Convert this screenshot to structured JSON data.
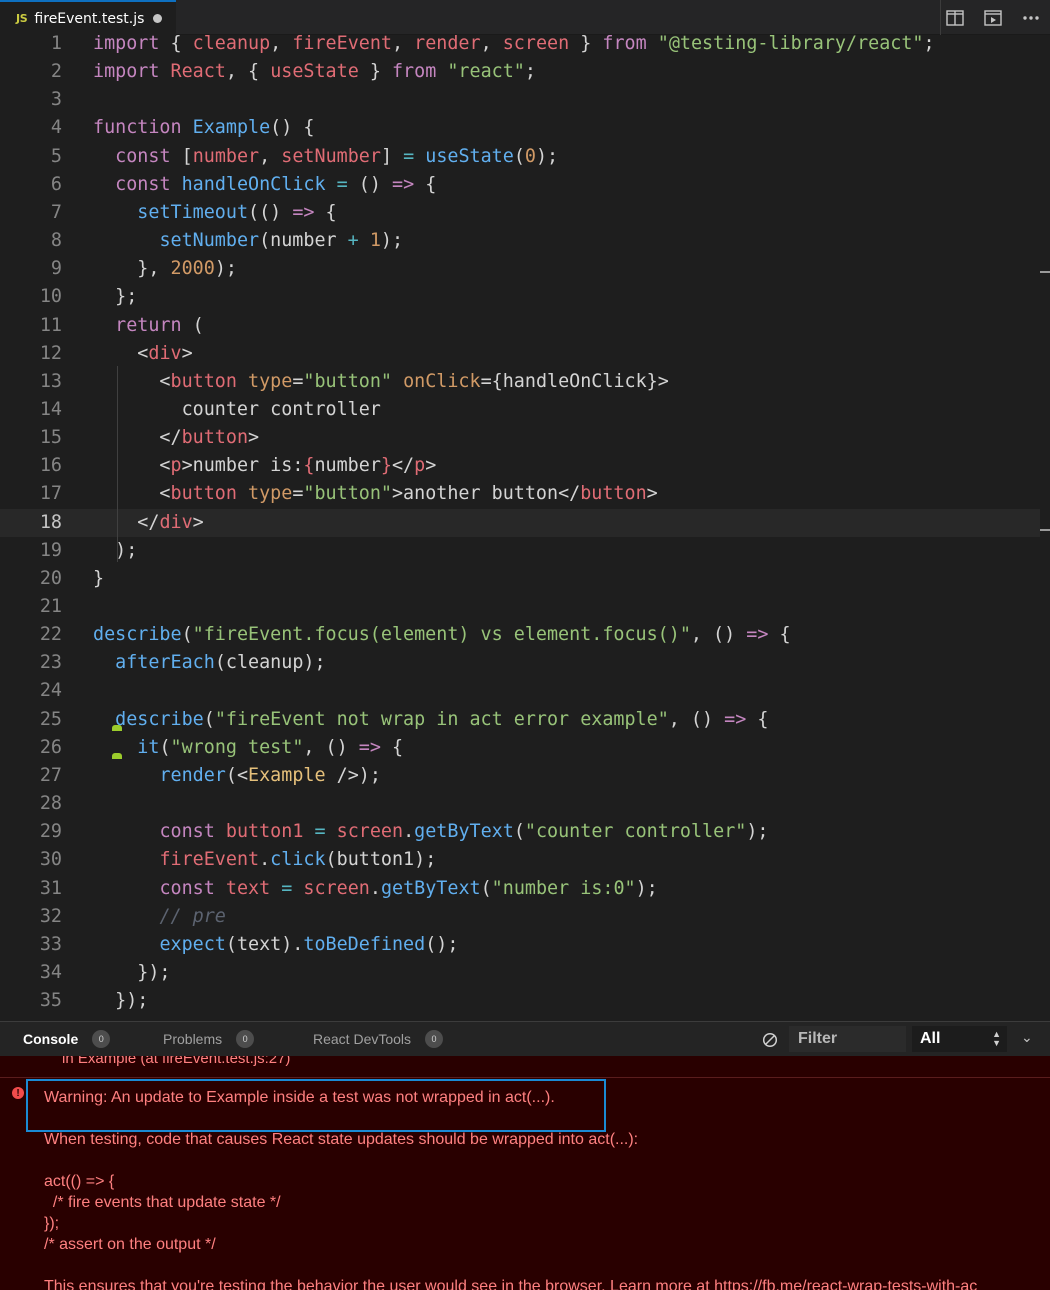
{
  "tab": {
    "icon_text": "JS",
    "title": "fireEvent.test.js"
  },
  "tab_actions": [
    "split-editor",
    "open-preview",
    "more-actions"
  ],
  "editor": {
    "current_line": 18,
    "lines": [
      {
        "n": "1"
      },
      {
        "n": "2"
      },
      {
        "n": "3"
      },
      {
        "n": "4"
      },
      {
        "n": "5"
      },
      {
        "n": "6"
      },
      {
        "n": "7"
      },
      {
        "n": "8"
      },
      {
        "n": "9"
      },
      {
        "n": "10"
      },
      {
        "n": "11"
      },
      {
        "n": "12"
      },
      {
        "n": "13"
      },
      {
        "n": "14"
      },
      {
        "n": "15"
      },
      {
        "n": "16"
      },
      {
        "n": "17"
      },
      {
        "n": "18"
      },
      {
        "n": "19"
      },
      {
        "n": "20"
      },
      {
        "n": "21"
      },
      {
        "n": "22"
      },
      {
        "n": "23"
      },
      {
        "n": "24"
      },
      {
        "n": "25"
      },
      {
        "n": "26"
      },
      {
        "n": "27"
      },
      {
        "n": "28"
      },
      {
        "n": "29"
      },
      {
        "n": "30"
      },
      {
        "n": "31"
      },
      {
        "n": "32"
      },
      {
        "n": "33"
      },
      {
        "n": "34"
      },
      {
        "n": "35"
      }
    ],
    "code": [
      [
        [
          "k",
          "import"
        ],
        [
          "p",
          " { "
        ],
        [
          "v",
          "cleanup"
        ],
        [
          "p",
          ", "
        ],
        [
          "v",
          "fireEvent"
        ],
        [
          "p",
          ", "
        ],
        [
          "v",
          "render"
        ],
        [
          "p",
          ", "
        ],
        [
          "v",
          "screen"
        ],
        [
          "p",
          " } "
        ],
        [
          "k",
          "from"
        ],
        [
          "p",
          " "
        ],
        [
          "s",
          "\"@testing-library/react\""
        ],
        [
          "p",
          ";"
        ]
      ],
      [
        [
          "k",
          "import"
        ],
        [
          "p",
          " "
        ],
        [
          "v",
          "React"
        ],
        [
          "p",
          ", { "
        ],
        [
          "v",
          "useState"
        ],
        [
          "p",
          " } "
        ],
        [
          "k",
          "from"
        ],
        [
          "p",
          " "
        ],
        [
          "s",
          "\"react\""
        ],
        [
          "p",
          ";"
        ]
      ],
      [],
      [
        [
          "k",
          "function"
        ],
        [
          "p",
          " "
        ],
        [
          "f",
          "Example"
        ],
        [
          "p",
          "() {"
        ]
      ],
      [
        [
          "p",
          "  "
        ],
        [
          "k",
          "const"
        ],
        [
          "p",
          " ["
        ],
        [
          "v",
          "number"
        ],
        [
          "p",
          ", "
        ],
        [
          "v",
          "setNumber"
        ],
        [
          "p",
          "] "
        ],
        [
          "cy",
          "="
        ],
        [
          "p",
          " "
        ],
        [
          "f",
          "useState"
        ],
        [
          "p",
          "("
        ],
        [
          "n",
          "0"
        ],
        [
          "p",
          ");"
        ]
      ],
      [
        [
          "p",
          "  "
        ],
        [
          "k",
          "const"
        ],
        [
          "p",
          " "
        ],
        [
          "f",
          "handleOnClick"
        ],
        [
          "p",
          " "
        ],
        [
          "cy",
          "="
        ],
        [
          "p",
          " () "
        ],
        [
          "k",
          "=>"
        ],
        [
          "p",
          " {"
        ]
      ],
      [
        [
          "p",
          "    "
        ],
        [
          "f",
          "setTimeout"
        ],
        [
          "p",
          "(() "
        ],
        [
          "k",
          "=>"
        ],
        [
          "p",
          " {"
        ]
      ],
      [
        [
          "p",
          "      "
        ],
        [
          "f",
          "setNumber"
        ],
        [
          "p",
          "(number "
        ],
        [
          "cy",
          "+"
        ],
        [
          "p",
          " "
        ],
        [
          "n",
          "1"
        ],
        [
          "p",
          ");"
        ]
      ],
      [
        [
          "p",
          "    }, "
        ],
        [
          "n",
          "2000"
        ],
        [
          "p",
          ");"
        ]
      ],
      [
        [
          "p",
          "  };"
        ]
      ],
      [
        [
          "p",
          "  "
        ],
        [
          "k",
          "return"
        ],
        [
          "p",
          " ("
        ]
      ],
      [
        [
          "p",
          "    <"
        ],
        [
          "t",
          "div"
        ],
        [
          "p",
          ">"
        ]
      ],
      [
        [
          "p",
          "      <"
        ],
        [
          "t",
          "button"
        ],
        [
          "p",
          " "
        ],
        [
          "a",
          "type"
        ],
        [
          "p",
          "="
        ],
        [
          "s",
          "\"button\""
        ],
        [
          "p",
          " "
        ],
        [
          "a",
          "onClick"
        ],
        [
          "p",
          "={handleOnClick}>"
        ]
      ],
      [
        [
          "tx",
          "        counter controller"
        ]
      ],
      [
        [
          "p",
          "      </"
        ],
        [
          "t",
          "button"
        ],
        [
          "p",
          ">"
        ]
      ],
      [
        [
          "p",
          "      <"
        ],
        [
          "t",
          "p"
        ],
        [
          "p",
          ">number is:"
        ],
        [
          "t",
          "{"
        ],
        [
          "p",
          "number"
        ],
        [
          "t",
          "}"
        ],
        [
          "p",
          "</"
        ],
        [
          "t",
          "p"
        ],
        [
          "p",
          ">"
        ]
      ],
      [
        [
          "p",
          "      <"
        ],
        [
          "t",
          "button"
        ],
        [
          "p",
          " "
        ],
        [
          "a",
          "type"
        ],
        [
          "p",
          "="
        ],
        [
          "s",
          "\"button\""
        ],
        [
          "p",
          ">another button</"
        ],
        [
          "t",
          "button"
        ],
        [
          "p",
          ">"
        ]
      ],
      [
        [
          "p",
          "    </"
        ],
        [
          "t",
          "div"
        ],
        [
          "p",
          ">"
        ]
      ],
      [
        [
          "p",
          "  );"
        ]
      ],
      [
        [
          "p",
          "}"
        ]
      ],
      [],
      [
        [
          "f",
          "describe"
        ],
        [
          "p",
          "("
        ],
        [
          "s",
          "\"fireEvent.focus(element) vs element.focus()\""
        ],
        [
          "p",
          ", () "
        ],
        [
          "k",
          "=>"
        ],
        [
          "p",
          " {"
        ]
      ],
      [
        [
          "p",
          "  "
        ],
        [
          "f",
          "afterEach"
        ],
        [
          "p",
          "(cleanup);"
        ]
      ],
      [],
      [
        [
          "p",
          "  "
        ],
        [
          "f",
          "describe"
        ],
        [
          "p",
          "("
        ],
        [
          "s",
          "\"fireEvent not wrap in act error example\""
        ],
        [
          "p",
          ", () "
        ],
        [
          "k",
          "=>"
        ],
        [
          "p",
          " {"
        ]
      ],
      [
        [
          "p",
          "    "
        ],
        [
          "f",
          "it"
        ],
        [
          "p",
          "("
        ],
        [
          "s",
          "\"wrong test\""
        ],
        [
          "p",
          ", () "
        ],
        [
          "k",
          "=>"
        ],
        [
          "p",
          " {"
        ]
      ],
      [
        [
          "p",
          "      "
        ],
        [
          "f",
          "render"
        ],
        [
          "p",
          "(<"
        ],
        [
          "cls",
          "Example"
        ],
        [
          "p",
          " />);"
        ]
      ],
      [],
      [
        [
          "p",
          "      "
        ],
        [
          "k",
          "const"
        ],
        [
          "p",
          " "
        ],
        [
          "v",
          "button1"
        ],
        [
          "p",
          " "
        ],
        [
          "cy",
          "="
        ],
        [
          "p",
          " "
        ],
        [
          "v",
          "screen"
        ],
        [
          "p",
          "."
        ],
        [
          "f",
          "getByText"
        ],
        [
          "p",
          "("
        ],
        [
          "s",
          "\"counter controller\""
        ],
        [
          "p",
          ");"
        ]
      ],
      [
        [
          "p",
          "      "
        ],
        [
          "v",
          "fireEvent"
        ],
        [
          "p",
          "."
        ],
        [
          "f",
          "click"
        ],
        [
          "p",
          "(button1);"
        ]
      ],
      [
        [
          "p",
          "      "
        ],
        [
          "k",
          "const"
        ],
        [
          "p",
          " "
        ],
        [
          "v",
          "text"
        ],
        [
          "p",
          " "
        ],
        [
          "cy",
          "="
        ],
        [
          "p",
          " "
        ],
        [
          "v",
          "screen"
        ],
        [
          "p",
          "."
        ],
        [
          "f",
          "getByText"
        ],
        [
          "p",
          "("
        ],
        [
          "s",
          "\"number is:0\""
        ],
        [
          "p",
          ");"
        ]
      ],
      [
        [
          "p",
          "      "
        ],
        [
          "c",
          "// pre"
        ]
      ],
      [
        [
          "p",
          "      "
        ],
        [
          "f",
          "expect"
        ],
        [
          "p",
          "(text)."
        ],
        [
          "f",
          "toBeDefined"
        ],
        [
          "p",
          "();"
        ]
      ],
      [
        [
          "p",
          "    });"
        ]
      ],
      [
        [
          "p",
          "  });"
        ]
      ]
    ]
  },
  "panel": {
    "tabs": [
      {
        "label": "Console",
        "count": "0"
      },
      {
        "label": "Problems",
        "count": "0"
      },
      {
        "label": "React DevTools",
        "count": "0"
      }
    ],
    "filter_placeholder": "Filter",
    "level": "All"
  },
  "console": {
    "previous_entry": "in Example (at fireEvent.test.js:27)",
    "error_icon": "!",
    "warning_lines": [
      "Warning: An update to Example inside a test was not wrapped in act(...).",
      "",
      "When testing, code that causes React state updates should be wrapped into act(...):",
      "",
      "act(() => {",
      "  /* fire events that update state */",
      "});",
      "/* assert on the output */",
      "",
      "This ensures that you're testing the behavior the user would see in the browser. Learn more at https://fb.me/react-wrap-tests-with-ac"
    ]
  },
  "colors": {
    "accent": "#0e70c0",
    "error_bg": "#290000",
    "error_text": "#ff8080",
    "highlight": "#1a8ad4"
  }
}
